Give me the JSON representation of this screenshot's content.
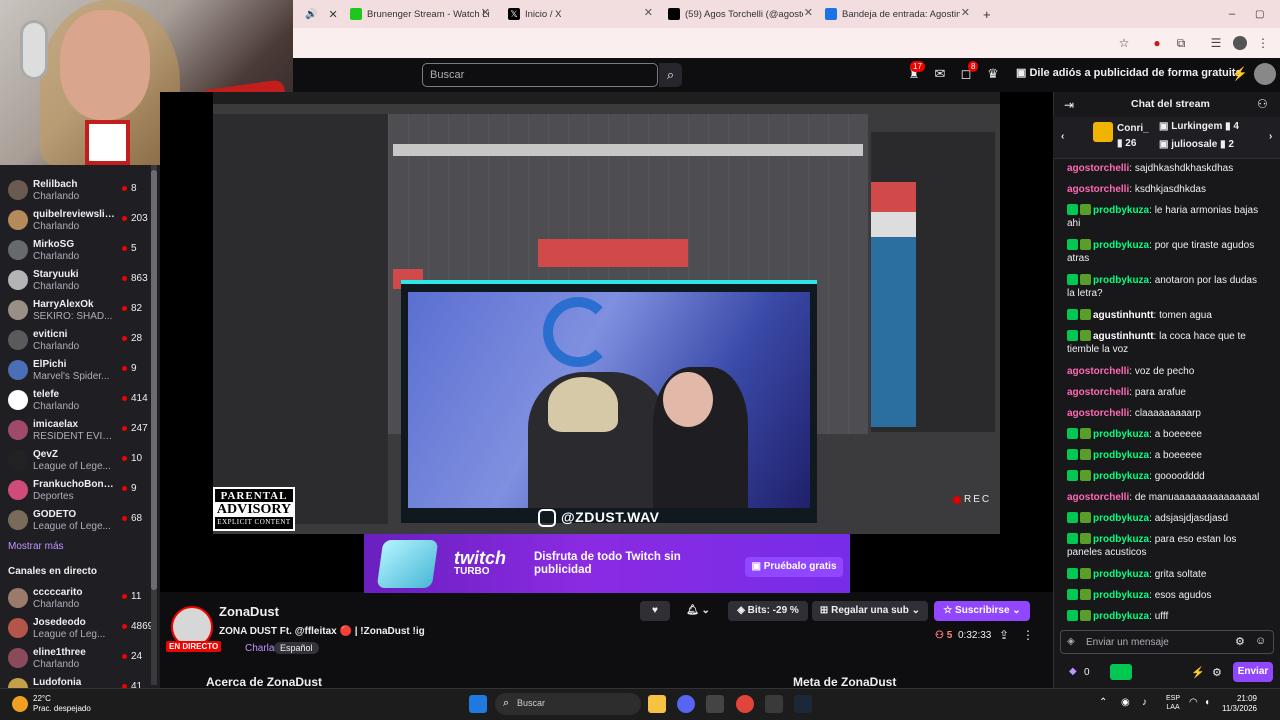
{
  "browser": {
    "tabs": [
      {
        "label": "",
        "color": "#333333"
      },
      {
        "label": "Brunenger Stream - Watch Live",
        "color": "#1ec71e"
      },
      {
        "label": "Inicio / X",
        "color": "#000000"
      },
      {
        "label": "(59) Agos Torchelli (@agostorch...",
        "color": "#000000"
      },
      {
        "label": "Bandeja de entrada: Agostina T...",
        "color": "#1a73e8"
      }
    ]
  },
  "topnav": {
    "search_placeholder": "Buscar",
    "notif_count": "17",
    "whisper_count": "8",
    "ad_free": "Dile adiós a publicidad de forma gratuita"
  },
  "sidebar": {
    "channels": [
      {
        "name": "Relilbach",
        "game": "Charlando",
        "viewers": "8",
        "color": "#6b5a4f"
      },
      {
        "name": "quibelreviewslive",
        "game": "Charlando",
        "viewers": "203",
        "color": "#b58a5a"
      },
      {
        "name": "MirkoSG",
        "game": "Charlando",
        "viewers": "5",
        "color": "#666a6f"
      },
      {
        "name": "Staryuuki",
        "game": "Charlando",
        "viewers": "863",
        "color": "#b4b4b4"
      },
      {
        "name": "HarryAlexOk",
        "game": "SEKIRO: SHAD...",
        "viewers": "82",
        "color": "#9a8f86"
      },
      {
        "name": "eviticni",
        "game": "Charlando",
        "viewers": "28",
        "color": "#5a5a5a"
      },
      {
        "name": "ElPichi",
        "game": "Marvel's Spider...",
        "viewers": "9",
        "color": "#4a6fb5"
      },
      {
        "name": "telefe",
        "game": "Charlando",
        "viewers": "414",
        "color": "#ffffff"
      },
      {
        "name": "imicaelax",
        "game": "RESIDENT EVIL...",
        "viewers": "247",
        "color": "#a04a6a"
      },
      {
        "name": "QevZ",
        "game": "League of Lege...",
        "viewers": "10",
        "color": "#222222"
      },
      {
        "name": "FrankuchoBone...",
        "game": "Deportes",
        "viewers": "9",
        "color": "#d04a7a"
      },
      {
        "name": "GODETO",
        "game": "League of Lege...",
        "viewers": "68",
        "color": "#7a6a5a"
      }
    ],
    "show_more": "Mostrar más",
    "live_header": "Canales en directo",
    "live_channels": [
      {
        "name": "cccccarito",
        "game": "Charlando",
        "viewers": "11",
        "color": "#9a7a6a"
      },
      {
        "name": "Josedeodo",
        "game": "League of Leg...",
        "viewers": "4869",
        "color": "#b4554a"
      },
      {
        "name": "eline1three",
        "game": "Charlando",
        "viewers": "24",
        "color": "#8a4a5a"
      },
      {
        "name": "Ludofonia",
        "game": "",
        "viewers": "41",
        "color": "#c4a04a"
      }
    ]
  },
  "player": {
    "ig_handle": "@ZDUST.WAV",
    "parental_line1": "PARENTAL",
    "parental_line2": "ADVISORY",
    "parental_line3": "EXPLICIT CONTENT",
    "rec": "REC"
  },
  "ad": {
    "logo": "twitch",
    "logo_sub": "TURBO",
    "text": "Disfruta de todo Twitch sin publicidad",
    "button": "Pruébalo gratis"
  },
  "stream": {
    "name": "ZonaDust",
    "title": "ZONA DUST Ft. @ffleitax 🔴 | !ZonaDust !ig",
    "live_badge": "EN DIRECTO",
    "category": "Charlando",
    "language": "Español",
    "bits": "Bits: -29 %",
    "gift_sub": "Regalar una sub",
    "subscribe": "Suscribirse",
    "viewers": "5",
    "uptime": "0:32:33",
    "about": "Acerca de ZonaDust",
    "meta": "Meta de ZonaDust"
  },
  "chat": {
    "header": "Chat del stream",
    "gifts": [
      {
        "name": "Conri_",
        "count": "26"
      },
      {
        "name": "Lurkingem",
        "count": "4"
      },
      {
        "name": "julioosale",
        "count": "2"
      }
    ],
    "messages": [
      {
        "user": "agostorchelli",
        "text": "sajdhkashdkhaskdhas",
        "color": "#ff69b4",
        "badge": false
      },
      {
        "user": "agostorchelli",
        "text": "ksdhkjasdhkdas",
        "color": "#ff69b4",
        "badge": false
      },
      {
        "user": "prodbykuza",
        "text": "le haria armonias bajas ahi",
        "color": "#00ff7f",
        "badge": true
      },
      {
        "user": "prodbykuza",
        "text": "por que tiraste agudos atras",
        "color": "#00ff7f",
        "badge": true
      },
      {
        "user": "prodbykuza",
        "text": "anotaron por las dudas la letra?",
        "color": "#00ff7f",
        "badge": true
      },
      {
        "user": "agustinhuntt",
        "text": "tomen agua",
        "color": "#ffffff",
        "badge": true
      },
      {
        "user": "agustinhuntt",
        "text": "la coca hace que te tiemble la voz",
        "color": "#ffffff",
        "badge": true
      },
      {
        "user": "agostorchelli",
        "text": "voz de pecho",
        "color": "#ff69b4",
        "badge": false
      },
      {
        "user": "agostorchelli",
        "text": "para arafue",
        "color": "#ff69b4",
        "badge": false
      },
      {
        "user": "agostorchelli",
        "text": "claaaaaaaaarp",
        "color": "#ff69b4",
        "badge": false
      },
      {
        "user": "prodbykuza",
        "text": "a boeeeee",
        "color": "#00ff7f",
        "badge": true
      },
      {
        "user": "prodbykuza",
        "text": "a boeeeee",
        "color": "#00ff7f",
        "badge": true
      },
      {
        "user": "prodbykuza",
        "text": "goooodddd",
        "color": "#00ff7f",
        "badge": true
      },
      {
        "user": "agostorchelli",
        "text": "de manuaaaaaaaaaaaaaaal",
        "color": "#ff69b4",
        "badge": false
      },
      {
        "user": "prodbykuza",
        "text": "adsjasjdjasdjasd",
        "color": "#00ff7f",
        "badge": true
      },
      {
        "user": "prodbykuza",
        "text": "para eso estan los paneles acusticos",
        "color": "#00ff7f",
        "badge": true
      },
      {
        "user": "prodbykuza",
        "text": "grita soltate",
        "color": "#00ff7f",
        "badge": true
      },
      {
        "user": "prodbykuza",
        "text": "esos agudos",
        "color": "#00ff7f",
        "badge": true
      },
      {
        "user": "prodbykuza",
        "text": "ufff",
        "color": "#00ff7f",
        "badge": true
      }
    ],
    "input_placeholder": "Enviar un mensaje",
    "points": "0",
    "send": "Enviar"
  },
  "taskbar": {
    "temp": "22°C",
    "weather": "Prac. despejado",
    "search": "Buscar",
    "lang1": "ESP",
    "lang2": "LAA",
    "time": "21:09",
    "date": "11/3/2026"
  }
}
